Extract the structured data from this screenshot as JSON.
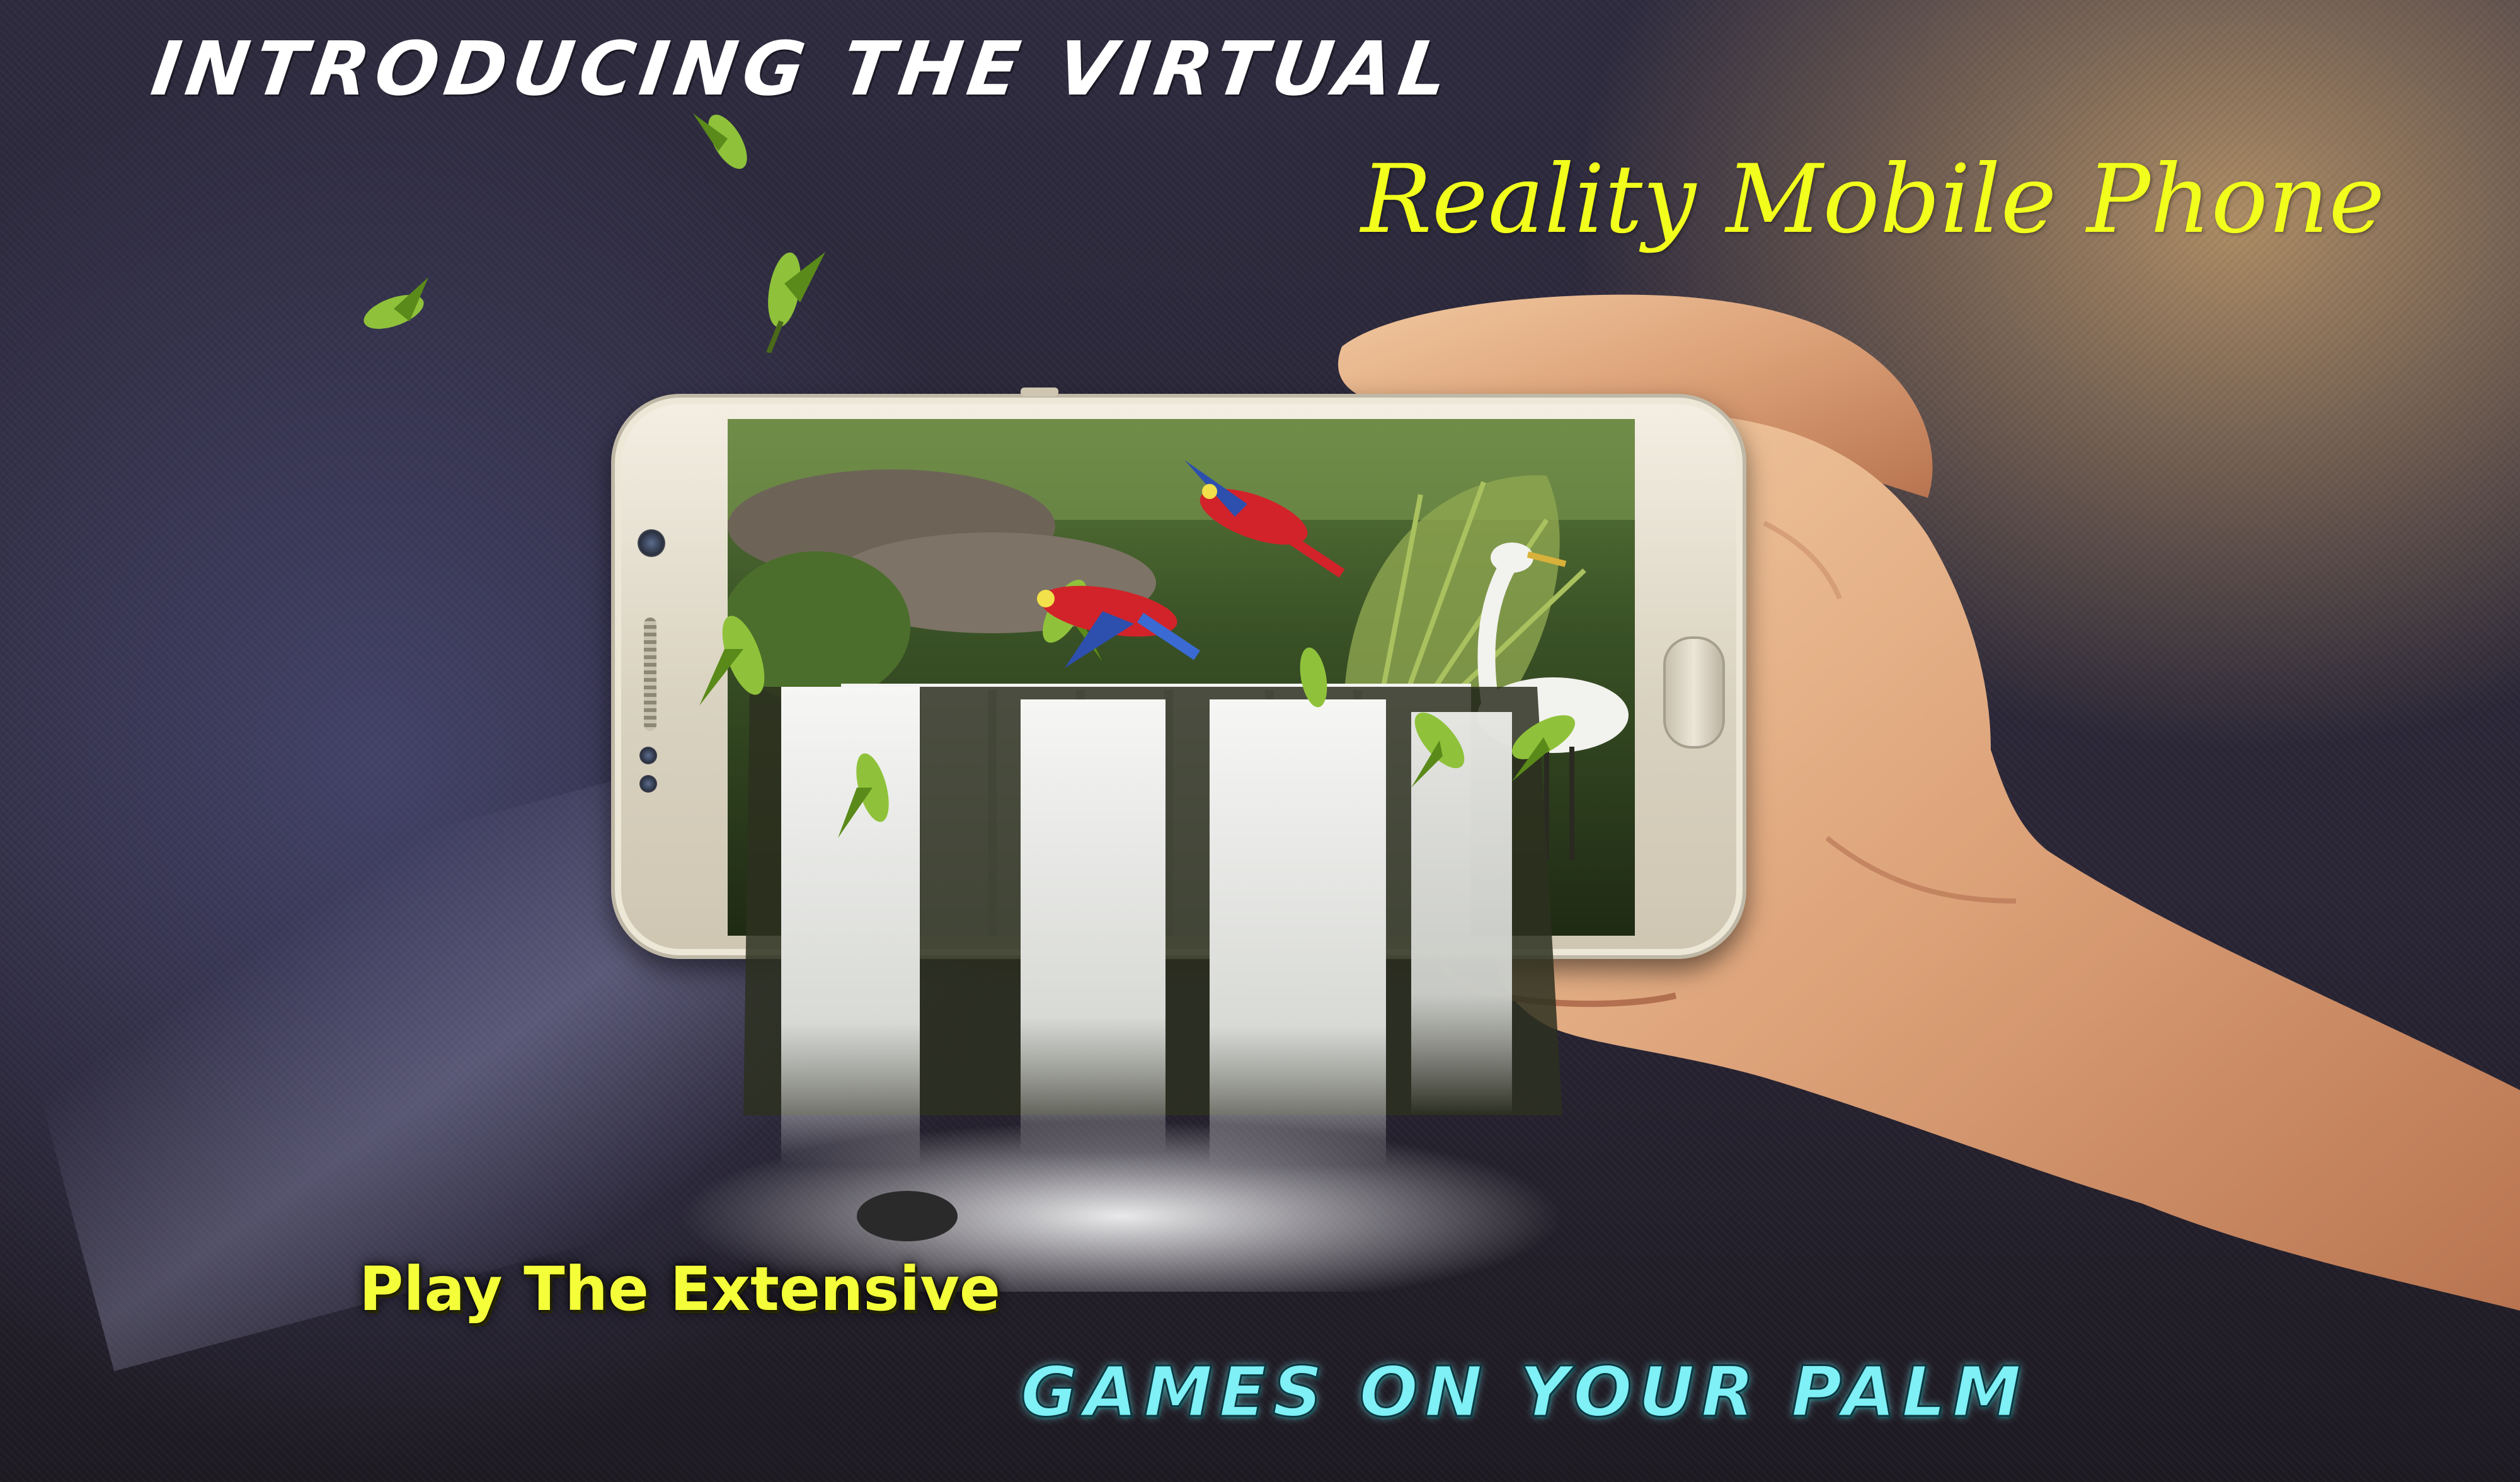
{
  "headline": "INTRODUCING THE VIRTUAL",
  "subheadline": "Reality Mobile Phone",
  "tagline_primary": "Play The Extensive",
  "tagline_secondary": "GAMES ON YOUR PALM",
  "colors": {
    "headline": "#ffffff",
    "subheadline": "#f2ff1c",
    "tagline_primary": "#f4ff3a",
    "tagline_secondary": "#7ef0f6",
    "background_dark": "#2a2538",
    "background_warm": "#c49e6c"
  },
  "icons": [
    "parrot-icon",
    "macaw-icon",
    "egret-icon",
    "waterfall-scene",
    "smartphone",
    "hand"
  ]
}
